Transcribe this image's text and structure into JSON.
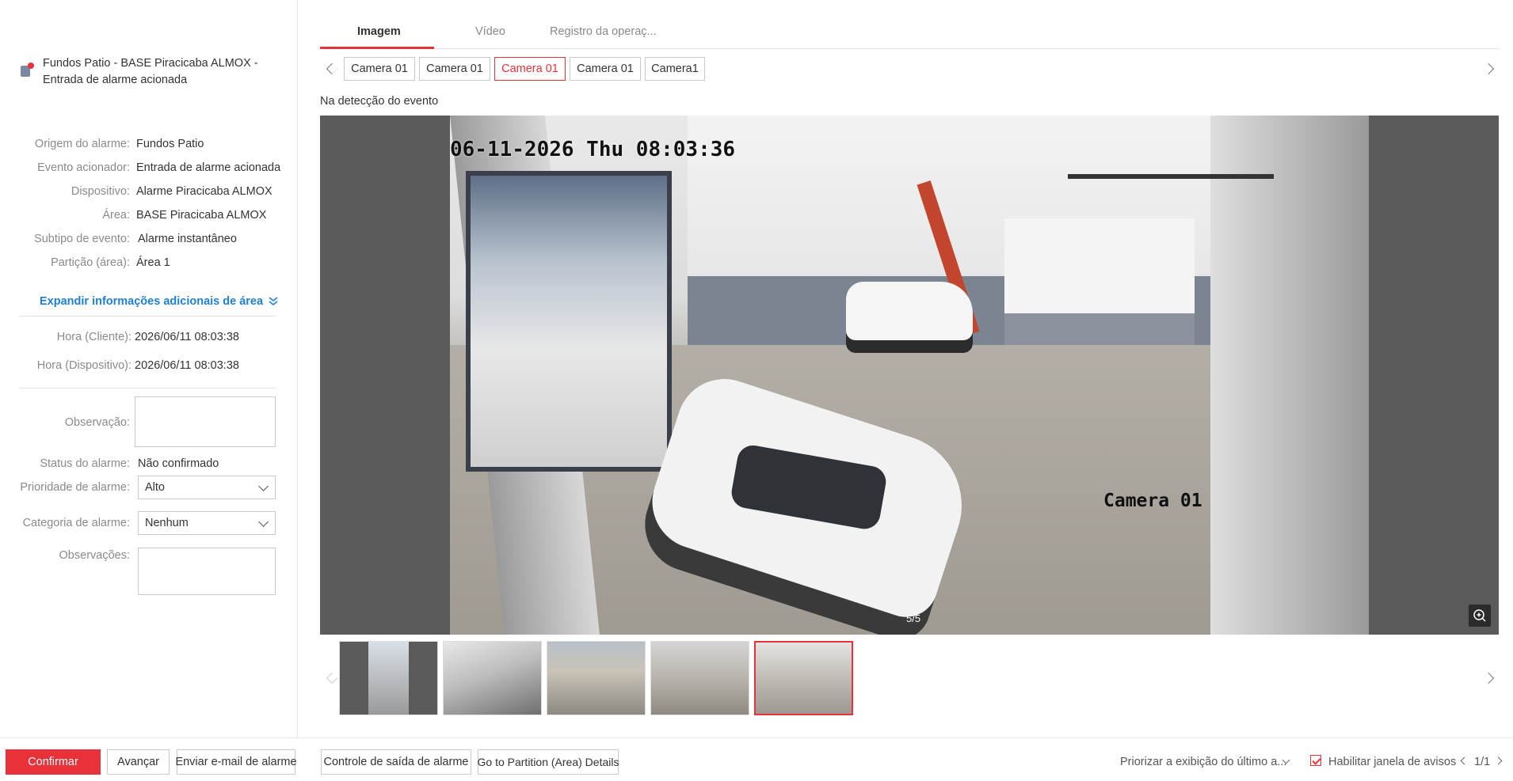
{
  "alarm": {
    "title_line1": "Fundos Patio - BASE Piracicaba ALMOX -",
    "title_line2": "Entrada de alarme acionada"
  },
  "info": [
    {
      "label": "Origem do alarme:",
      "value": "Fundos Patio"
    },
    {
      "label": "Evento acionador:",
      "value": "Entrada de alarme acionada"
    },
    {
      "label": "Dispositivo:",
      "value": "Alarme Piracicaba ALMOX"
    },
    {
      "label": "Área:",
      "value": "BASE Piracicaba ALMOX"
    },
    {
      "label": "Subtipo de evento:",
      "value": "Alarme instantâneo"
    },
    {
      "label": "Partição (área):",
      "value": "Área 1"
    }
  ],
  "expand_link": "Expandir informações adicionais de área",
  "times": [
    {
      "label": "Hora (Cliente):",
      "value": "2026/06/11 08:03:38"
    },
    {
      "label": "Hora (Dispositivo):",
      "value": "2026/06/11 08:03:38"
    }
  ],
  "form": {
    "observacao_label": "Observação:",
    "status_label": "Status do alarme:",
    "status_value": "Não confirmado",
    "prioridade_label": "Prioridade de alarme:",
    "prioridade_value": "Alto",
    "categoria_label": "Categoria de alarme:",
    "categoria_value": "Nenhum",
    "observacoes_label": "Observações:"
  },
  "tabs": [
    {
      "label": "Imagem",
      "active": true
    },
    {
      "label": "Vídeo",
      "active": false
    },
    {
      "label": "Registro da operaç...",
      "active": false
    }
  ],
  "cameras": [
    {
      "label": "Camera 01",
      "active": false
    },
    {
      "label": "Camera 01",
      "active": false
    },
    {
      "label": "Camera 01",
      "active": true
    },
    {
      "label": "Camera 01",
      "active": false
    },
    {
      "label": "Camera1",
      "active": false
    }
  ],
  "event_label": "Na detecção do evento",
  "viewer": {
    "osd_time": "06-11-2026 Thu 08:03:36",
    "osd_camera": "Camera 01",
    "page_count": "5/5"
  },
  "footer": {
    "confirm": "Confirmar",
    "next": "Avançar",
    "email": "Enviar e-mail de alarme",
    "output_control": "Controle de saída de alarme",
    "partition_details": "Go to Partition (Area) Details",
    "priority_display": "Priorizar a exibição do último a...",
    "enable_popup": "Habilitar janela de avisos",
    "pager": "1/1"
  },
  "colors": {
    "accent": "#e9313a",
    "link": "#1f7fd6"
  }
}
